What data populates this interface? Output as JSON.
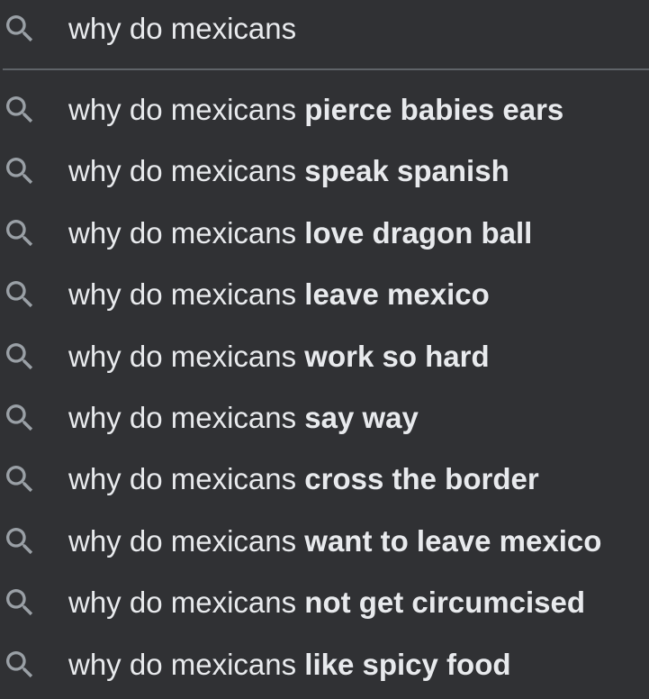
{
  "search": {
    "query": "why do mexicans",
    "icon": "search-icon"
  },
  "colors": {
    "background": "#303134",
    "text": "#e8eaed",
    "icon": "#9aa0a6",
    "divider": "#5f6368"
  },
  "suggestions": [
    {
      "prefix": "why do mexicans",
      "completion": "pierce babies ears"
    },
    {
      "prefix": "why do mexicans",
      "completion": "speak spanish"
    },
    {
      "prefix": "why do mexicans",
      "completion": "love dragon ball"
    },
    {
      "prefix": "why do mexicans",
      "completion": "leave mexico"
    },
    {
      "prefix": "why do mexicans",
      "completion": "work so hard"
    },
    {
      "prefix": "why do mexicans",
      "completion": "say way"
    },
    {
      "prefix": "why do mexicans",
      "completion": "cross the border"
    },
    {
      "prefix": "why do mexicans",
      "completion": "want to leave mexico"
    },
    {
      "prefix": "why do mexicans",
      "completion": "not get circumcised"
    },
    {
      "prefix": "why do mexicans",
      "completion": "like spicy food"
    }
  ]
}
